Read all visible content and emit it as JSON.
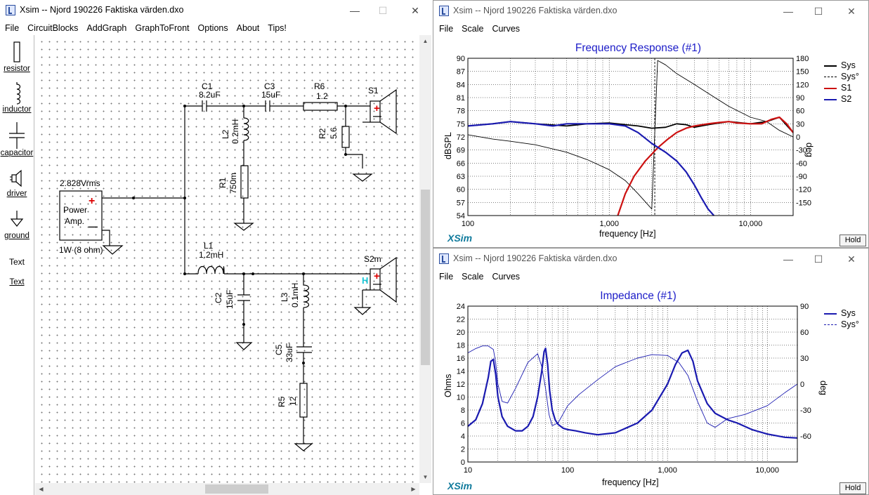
{
  "main_window": {
    "title": "Xsim -- Njord 190226 Faktiska värden.dxo",
    "controls": {
      "minimize": "—",
      "maximize": "☐",
      "close": "✕"
    },
    "menu": [
      "File",
      "CircuitBlocks",
      "AddGraph",
      "GraphToFront",
      "Options",
      "About",
      "Tips!"
    ],
    "palette": [
      {
        "label": "resistor",
        "icon": "resistor-icon"
      },
      {
        "label": "inductor",
        "icon": "inductor-icon"
      },
      {
        "label": "capacitor",
        "icon": "capacitor-icon"
      },
      {
        "label": "driver",
        "icon": "driver-icon"
      },
      {
        "label": "ground",
        "icon": "ground-icon"
      },
      {
        "label": "Text",
        "icon": "text-icon"
      },
      {
        "label": "Text",
        "icon": "text-link"
      }
    ]
  },
  "circuit": {
    "source": {
      "voltage": "2.828Vrms",
      "name_line1": "Power",
      "name_line2": "Amp.",
      "plus": "+",
      "minus": "—",
      "power": "1W (8 ohm)"
    },
    "components": {
      "C1": {
        "name": "C1",
        "value": "8.2uF"
      },
      "C3": {
        "name": "C3",
        "value": "15uF"
      },
      "R6": {
        "name": "R6",
        "value": "1.2"
      },
      "L2": {
        "name": "L2",
        "value": "0.2mH"
      },
      "R2": {
        "name": "R2",
        "value": "5.6"
      },
      "R1": {
        "name": "R1",
        "value": "750m"
      },
      "L1": {
        "name": "L1",
        "value": "1.2mH"
      },
      "C2": {
        "name": "C2",
        "value": "15uF"
      },
      "L3": {
        "name": "L3",
        "value": "0.1mH"
      },
      "C5": {
        "name": "C5",
        "value": "33uF"
      },
      "R5": {
        "name": "R5",
        "value": "12"
      }
    },
    "drivers": {
      "S1": {
        "name": "S1",
        "plus": "+",
        "minus": "—"
      },
      "S2m": {
        "name": "S2m",
        "plus": "+",
        "minus": "—",
        "marker": "H"
      }
    }
  },
  "freq_window": {
    "title": "Xsim -- Njord 190226 Faktiska värden.dxo",
    "menu": [
      "File",
      "Scale",
      "Curves"
    ],
    "controls": {
      "minimize": "—",
      "maximize": "☐",
      "close": "✕"
    },
    "brand": "XSim",
    "hold": "Hold",
    "chart_data": {
      "type": "line",
      "title": "Frequency Response (#1)",
      "xlabel": "frequency [Hz]",
      "ylabel": "dBSPL",
      "y2label": "deg",
      "x_scale": "log",
      "xlim": [
        100,
        20000
      ],
      "ylim": [
        54,
        90
      ],
      "y2lim": [
        -180,
        180
      ],
      "x_tick_labels": [
        "100",
        "1,000",
        "10,000"
      ],
      "y_tick_labels": [
        "90",
        "87",
        "84",
        "81",
        "78",
        "75",
        "72",
        "69",
        "66",
        "63",
        "60",
        "57",
        "54"
      ],
      "y2_tick_labels": [
        "180",
        "150",
        "120",
        "90",
        "60",
        "30",
        "0",
        "-30",
        "-60",
        "-90",
        "-120",
        "-150"
      ],
      "grid": true,
      "legend_position": "top-right",
      "cursor_x": 2100,
      "series": [
        {
          "name": "Sys",
          "color": "#000000",
          "style": "solid",
          "axis": "left",
          "x": [
            100,
            150,
            200,
            300,
            500,
            700,
            1000,
            1300,
            1600,
            2000,
            2500,
            3000,
            3500,
            4000,
            5000,
            7000,
            10000,
            13000,
            16000,
            20000
          ],
          "y": [
            74.5,
            75,
            75.5,
            75,
            74.5,
            75,
            75.2,
            74.8,
            74.5,
            74,
            74.2,
            75,
            74.8,
            74.2,
            74.8,
            75.5,
            75,
            75.5,
            76.5,
            73
          ]
        },
        {
          "name": "Sys°",
          "color": "#000000",
          "style": "dashed",
          "axis": "right",
          "x": [
            100,
            150,
            200,
            300,
            500,
            700,
            1000,
            1300,
            1600,
            2000,
            2200,
            2500,
            3000,
            4000,
            5000,
            7000,
            10000,
            13000,
            16000,
            20000
          ],
          "y": [
            5,
            -5,
            -10,
            -18,
            -35,
            -52,
            -75,
            -100,
            -130,
            -165,
            175,
            165,
            145,
            120,
            100,
            70,
            45,
            35,
            15,
            0
          ]
        },
        {
          "name": "S1",
          "color": "#cc1111",
          "style": "solid",
          "axis": "left",
          "x": [
            1150,
            1300,
            1500,
            1800,
            2200,
            2600,
            3000,
            3500,
            4000,
            5000,
            6000,
            7000,
            8000,
            10000,
            12000,
            14000,
            16000,
            18000,
            20000
          ],
          "y": [
            54,
            59,
            63,
            66.5,
            69.5,
            71.5,
            73,
            74,
            74.5,
            75,
            75.3,
            75.5,
            75.2,
            75,
            75,
            76,
            76.5,
            75,
            73
          ]
        },
        {
          "name": "S2",
          "color": "#1a1ab0",
          "style": "solid",
          "axis": "left",
          "x": [
            100,
            150,
            200,
            300,
            400,
            500,
            700,
            1000,
            1300,
            1600,
            2000,
            2500,
            3000,
            3500,
            4000,
            4500,
            5000,
            5500
          ],
          "y": [
            74.5,
            75,
            75.5,
            75,
            74.5,
            75,
            75,
            75,
            74.5,
            73,
            70.5,
            68.5,
            66.5,
            64,
            61,
            58,
            55.5,
            54
          ]
        }
      ]
    }
  },
  "imp_window": {
    "title": "Xsim -- Njord 190226 Faktiska värden.dxo",
    "menu": [
      "File",
      "Scale",
      "Curves"
    ],
    "controls": {
      "minimize": "—",
      "maximize": "☐",
      "close": "✕"
    },
    "brand": "XSim",
    "hold": "Hold",
    "chart_data": {
      "type": "line",
      "title": "Impedance (#1)",
      "xlabel": "frequency [Hz]",
      "ylabel": "Ohms",
      "y2label": "deg",
      "x_scale": "log",
      "xlim": [
        10,
        20000
      ],
      "ylim": [
        0,
        24
      ],
      "y2lim": [
        -90,
        90
      ],
      "x_tick_labels": [
        "10",
        "100",
        "1,000",
        "10,000"
      ],
      "y_tick_labels": [
        "24",
        "22",
        "20",
        "18",
        "16",
        "14",
        "12",
        "10",
        "8",
        "6",
        "4",
        "2",
        "0"
      ],
      "y2_tick_labels": [
        "90",
        "60",
        "30",
        "0",
        "-30",
        "-60"
      ],
      "grid": true,
      "legend_position": "top-right",
      "series": [
        {
          "name": "Sys",
          "color": "#1a1ab0",
          "style": "solid",
          "axis": "left",
          "x": [
            10,
            12,
            14,
            16,
            17,
            18,
            19,
            20,
            22,
            25,
            30,
            35,
            40,
            45,
            50,
            55,
            58,
            60,
            63,
            66,
            70,
            75,
            80,
            90,
            100,
            120,
            150,
            200,
            300,
            500,
            700,
            1000,
            1200,
            1400,
            1600,
            1800,
            2000,
            2500,
            3000,
            4000,
            5000,
            7000,
            10000,
            15000,
            20000
          ],
          "y": [
            5.5,
            6.5,
            9,
            13,
            15.5,
            15.8,
            13.5,
            10,
            7,
            5.5,
            4.8,
            4.8,
            5.5,
            7,
            10,
            14,
            17,
            17.5,
            15,
            11,
            8,
            6.5,
            5.8,
            5.2,
            5,
            4.8,
            4.5,
            4.2,
            4.5,
            6,
            8,
            12,
            15,
            16.8,
            17.2,
            15.5,
            12.5,
            9,
            7.5,
            6.5,
            6,
            5,
            4.3,
            3.8,
            3.7
          ]
        },
        {
          "name": "Sys°",
          "color": "#1a1ab0",
          "style": "thin",
          "axis": "right",
          "x": [
            10,
            12,
            14,
            16,
            18,
            19,
            20,
            22,
            25,
            30,
            40,
            50,
            55,
            60,
            65,
            70,
            80,
            100,
            130,
            200,
            300,
            500,
            700,
            1000,
            1300,
            1600,
            2000,
            2500,
            3000,
            4000,
            6000,
            10000,
            15000,
            20000
          ],
          "y": [
            36,
            41,
            44,
            44,
            40,
            25,
            0,
            -20,
            -22,
            -5,
            25,
            35,
            20,
            -5,
            -35,
            -48,
            -45,
            -25,
            -12,
            5,
            20,
            30,
            34,
            33,
            25,
            10,
            -20,
            -45,
            -50,
            -40,
            -35,
            -25,
            -10,
            0
          ]
        }
      ]
    }
  }
}
